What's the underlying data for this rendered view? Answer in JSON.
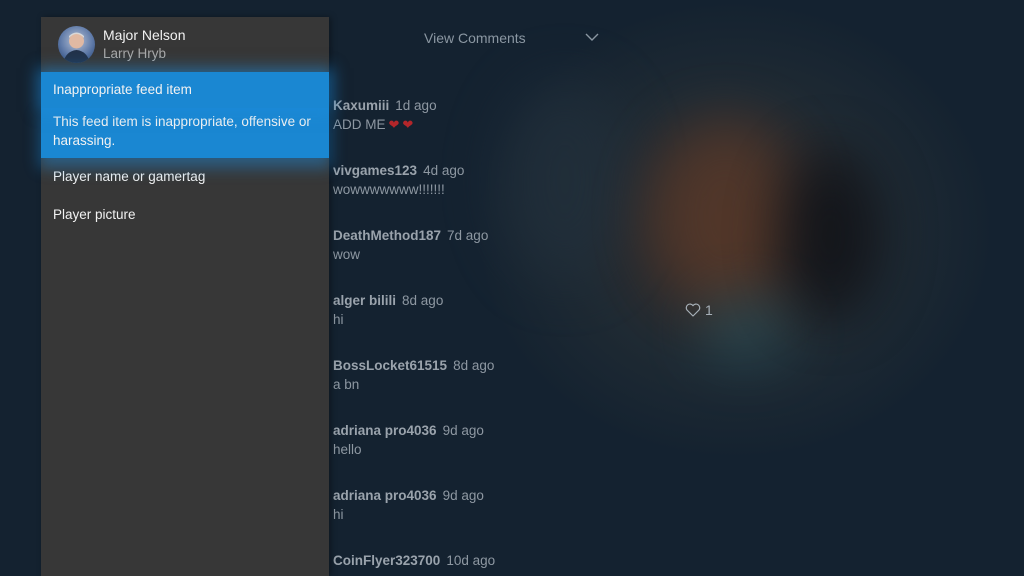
{
  "report_panel": {
    "profile": {
      "gamertag": "Major Nelson",
      "real_name": "Larry Hryb"
    },
    "options": [
      {
        "label": "Inappropriate feed item",
        "description": "This feed item is inappropriate, offensive or harassing.",
        "focused": true
      },
      {
        "label": "Player name or gamertag"
      },
      {
        "label": "Player picture"
      }
    ]
  },
  "comments_header": {
    "label": "View Comments",
    "icon": "chevron-down-icon"
  },
  "comments": [
    {
      "user": "Kaxumiii",
      "time": "1d ago",
      "text": "ADD ME",
      "hearts": 2
    },
    {
      "user": "vivgames123",
      "time": "4d ago",
      "text": "wowwwwwww!!!!!!!"
    },
    {
      "user": "DeathMethod187",
      "time": "7d ago",
      "text": "wow"
    },
    {
      "user": "alger bilili",
      "time": "8d ago",
      "text": "hi"
    },
    {
      "user": "BossLocket61515",
      "time": "8d ago",
      "text": "a bn"
    },
    {
      "user": "adriana pro4036",
      "time": "9d ago",
      "text": "hello"
    },
    {
      "user": "adriana pro4036",
      "time": "9d ago",
      "text": "hi"
    },
    {
      "user": "CoinFlyer323700",
      "time": "10d ago",
      "text": ""
    }
  ],
  "likes": {
    "count": "1",
    "icon": "heart-outline-icon"
  },
  "colors": {
    "accent": "#1a87d2",
    "panel": "#373737",
    "background": "#142230"
  }
}
